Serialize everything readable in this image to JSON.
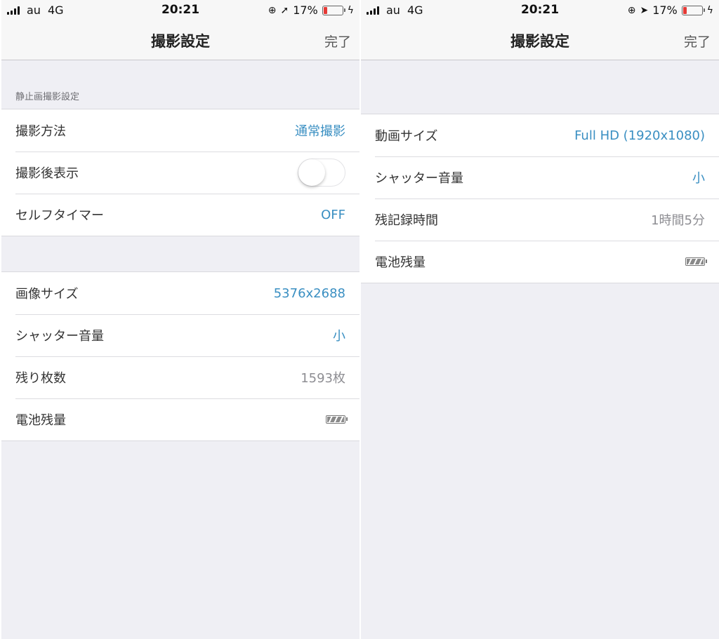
{
  "status_bar": {
    "carrier": "au",
    "network": "4G",
    "time": "20:21",
    "battery_percent": "17%",
    "battery_level": 0.17,
    "lock_icon": "rotation-lock-icon",
    "location_icon": "location-arrow-icon",
    "charging_icon": "charging-bolt-icon"
  },
  "left": {
    "nav": {
      "title": "撮影設定",
      "done": "完了"
    },
    "section_title": "静止画撮影設定",
    "group1": [
      {
        "label": "撮影方法",
        "value": "通常撮影"
      },
      {
        "label": "撮影後表示",
        "toggle_on": false
      },
      {
        "label": "セルフタイマー",
        "value": "OFF"
      }
    ],
    "group2": [
      {
        "label": "画像サイズ",
        "value": "5376x2688"
      },
      {
        "label": "シャッター音量",
        "value": "小"
      },
      {
        "label": "残り枚数",
        "value": "1593枚"
      },
      {
        "label": "電池残量",
        "icon": "battery-level-icon"
      }
    ]
  },
  "right": {
    "nav": {
      "title": "撮影設定",
      "done": "完了"
    },
    "group": [
      {
        "label": "動画サイズ",
        "value": "Full HD (1920x1080)"
      },
      {
        "label": "シャッター音量",
        "value": "小"
      },
      {
        "label": "残記録時間",
        "value": "1時間5分"
      },
      {
        "label": "電池残量",
        "icon": "battery-level-icon"
      }
    ]
  },
  "colors": {
    "accent": "#3a8fc2",
    "battery_low": "#e53935",
    "background": "#efeff4"
  }
}
